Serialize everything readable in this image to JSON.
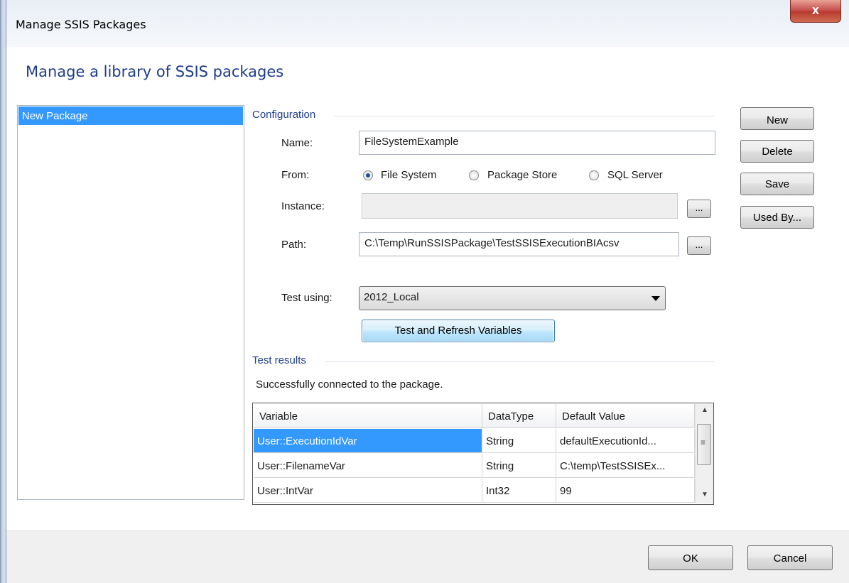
{
  "window": {
    "title": "Manage SSIS Packages",
    "close_glyph": "x"
  },
  "heading": "Manage a library of SSIS packages",
  "packages": {
    "items": [
      "New Package"
    ],
    "selected": 0
  },
  "configuration": {
    "group_label": "Configuration",
    "name_label": "Name:",
    "name_value": "FileSystemExample",
    "from_label": "From:",
    "from_options": [
      "File System",
      "Package Store",
      "SQL Server"
    ],
    "from_selected": "File System",
    "instance_label": "Instance:",
    "instance_value": "",
    "path_label": "Path:",
    "path_value": "C:\\Temp\\RunSSISPackage\\TestSSISExecutionBIAcsv",
    "browse_label": "...",
    "test_using_label": "Test using:",
    "test_using_value": "2012_Local",
    "test_button": "Test and Refresh Variables"
  },
  "test_results": {
    "group_label": "Test results",
    "message": "Successfully connected to the package.",
    "columns": [
      "Variable",
      "DataType",
      "Default Value"
    ],
    "rows": [
      [
        "User::ExecutionIdVar",
        "String",
        "defaultExecutionId..."
      ],
      [
        "User::FilenameVar",
        "String",
        "C:\\temp\\TestSSISEx..."
      ],
      [
        "User::IntVar",
        "Int32",
        "99"
      ]
    ],
    "selected_row": 0,
    "scroll_glyphs": {
      "up": "▲",
      "grip": "≡",
      "down": "▼"
    }
  },
  "side_buttons": {
    "new": "New",
    "delete": "Delete",
    "save": "Save",
    "used_by": "Used By..."
  },
  "footer": {
    "ok": "OK",
    "cancel": "Cancel"
  },
  "colors": {
    "accent": "#1e3c8c",
    "selection": "#3399ff"
  }
}
